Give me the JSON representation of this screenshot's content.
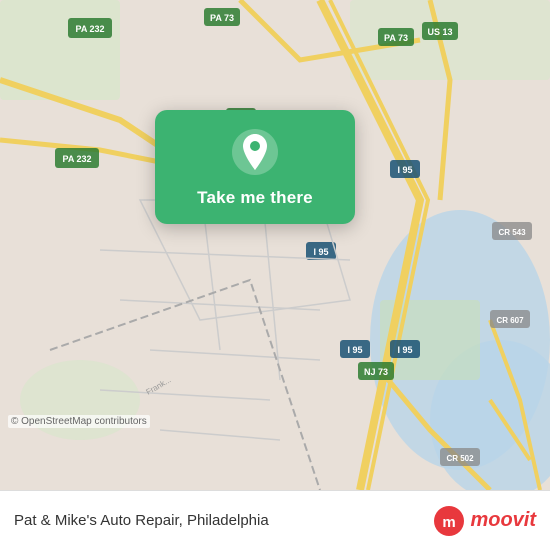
{
  "map": {
    "background_color": "#e8e0d8",
    "osm_credit": "© OpenStreetMap contributors"
  },
  "card": {
    "label": "Take me there",
    "background_color": "#3cb371"
  },
  "bottom_bar": {
    "place_name": "Pat & Mike's Auto Repair, Philadelphia",
    "moovit_text": "moovit"
  }
}
